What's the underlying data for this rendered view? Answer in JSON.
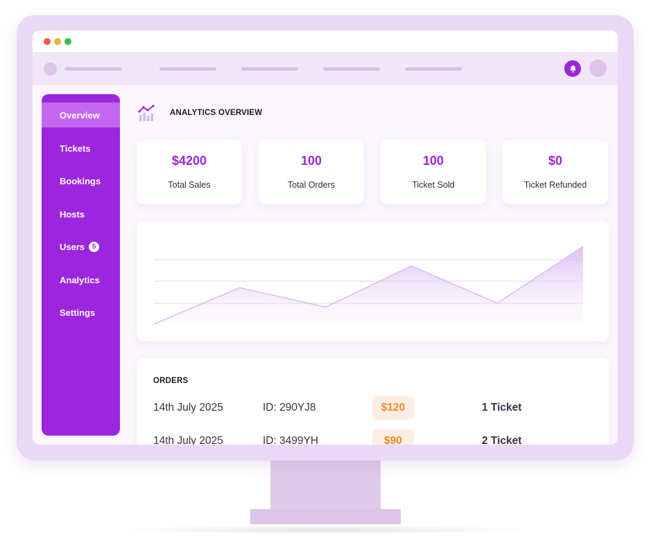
{
  "sidebar": {
    "items": [
      {
        "label": "Overview",
        "active": true
      },
      {
        "label": "Tickets"
      },
      {
        "label": "Bookings"
      },
      {
        "label": "Hosts"
      },
      {
        "label": "Users",
        "badge": "5"
      },
      {
        "label": "Analytics"
      },
      {
        "label": "Settings"
      }
    ]
  },
  "analytics": {
    "title": "ANALYTICS OVERVIEW",
    "icon": "analytics-chart-icon"
  },
  "stats": [
    {
      "value": "$4200",
      "label": "Total Sales"
    },
    {
      "value": "100",
      "label": "Total Orders"
    },
    {
      "value": "100",
      "label": "Ticket Sold"
    },
    {
      "value": "$0",
      "label": "Ticket Refunded"
    }
  ],
  "chart_data": {
    "type": "area",
    "title": "",
    "xlabel": "",
    "ylabel": "",
    "grid": true,
    "gridlines": 3,
    "ylim": [
      0,
      100
    ],
    "x": [
      0,
      1,
      2,
      3,
      4,
      5
    ],
    "values": [
      0,
      47,
      22,
      75,
      27,
      100
    ],
    "color": "#dcbcf0"
  },
  "orders": {
    "title": "ORDERS",
    "rows": [
      {
        "date": "14th July 2025",
        "id": "ID: 290YJ8",
        "amount": "$120",
        "qty": "1 Ticket"
      },
      {
        "date": "14th July 2025",
        "id": "ID: 3499YH",
        "amount": "$90",
        "qty": "2 Ticket"
      }
    ]
  },
  "colors": {
    "accent": "#9c25de",
    "accent_light": "#c367f0",
    "amount": "#f0892a",
    "bezel": "#ead9f5"
  }
}
